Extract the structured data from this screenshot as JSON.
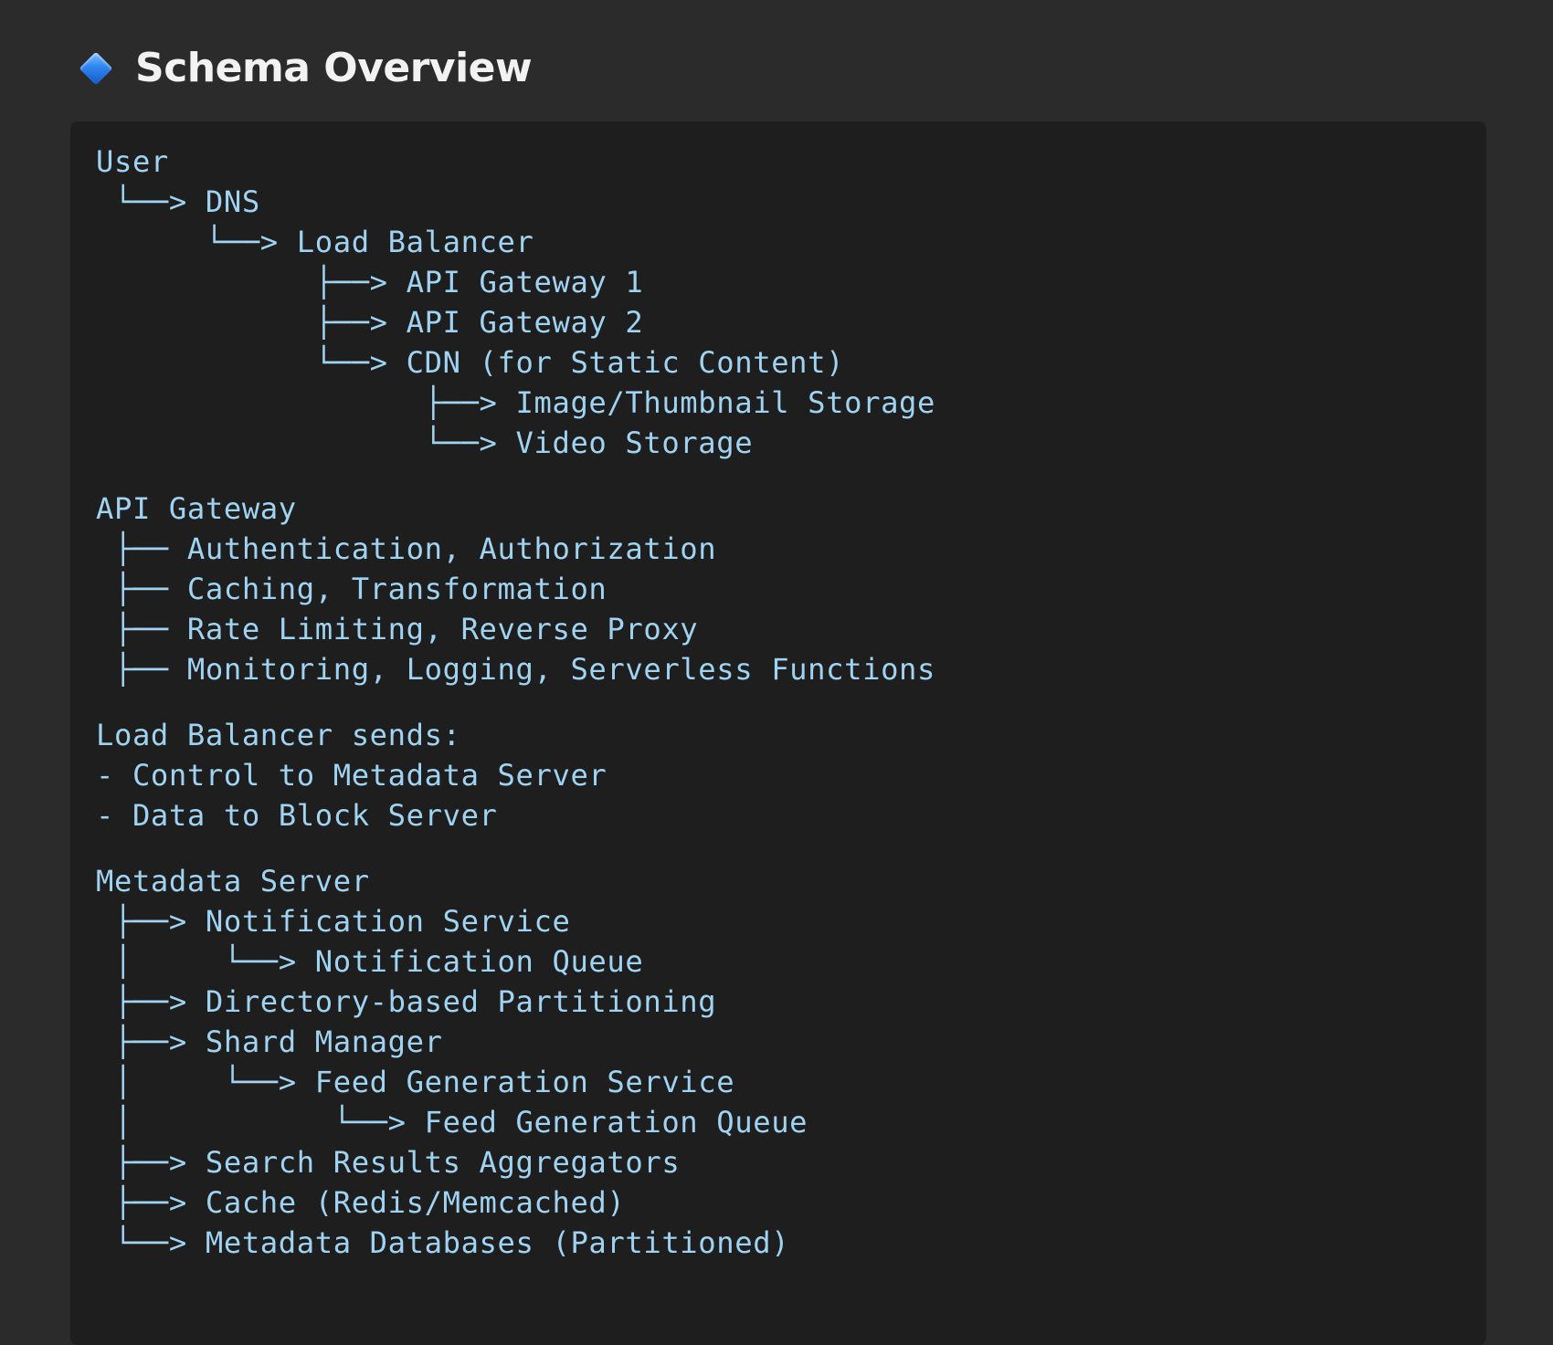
{
  "header": {
    "icon": "blue-diamond-icon",
    "title": "Schema Overview"
  },
  "code": {
    "lines": [
      "User",
      " └──> DNS",
      "      └──> Load Balancer",
      "            ├──> API Gateway 1",
      "            ├──> API Gateway 2",
      "            └──> CDN (for Static Content)",
      "                  ├──> Image/Thumbnail Storage",
      "                  └──> Video Storage",
      "",
      "API Gateway",
      " ├── Authentication, Authorization",
      " ├── Caching, Transformation",
      " ├── Rate Limiting, Reverse Proxy",
      " ├── Monitoring, Logging, Serverless Functions",
      "",
      "Load Balancer sends:",
      "- Control to Metadata Server",
      "- Data to Block Server",
      "",
      "Metadata Server",
      " ├──> Notification Service",
      " │     └──> Notification Queue",
      " ├──> Directory-based Partitioning",
      " ├──> Shard Manager",
      " │     └──> Feed Generation Service",
      " │           └──> Feed Generation Queue",
      " ├──> Search Results Aggregators",
      " ├──> Cache (Redis/Memcached)",
      " └──> Metadata Databases (Partitioned)"
    ]
  }
}
